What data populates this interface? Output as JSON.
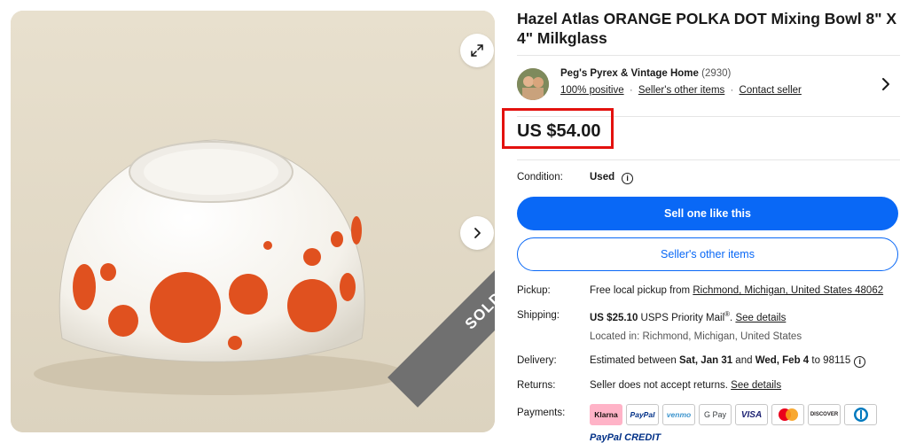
{
  "gallery": {
    "sold_label": "SOLD",
    "expand_icon": "expand-arrows-icon",
    "next_icon": "chevron-right-icon"
  },
  "listing": {
    "title": "Hazel Atlas ORANGE POLKA DOT Mixing Bowl 8\" X 4\" Milkglass",
    "price": "US $54.00"
  },
  "seller": {
    "name": "Peg's Pyrex & Vintage Home",
    "feedback_count": "(2930)",
    "positive": "100% positive",
    "other_items": "Seller's other items",
    "contact": "Contact seller",
    "separator": "·"
  },
  "condition": {
    "label": "Condition:",
    "value": "Used",
    "info_icon": "i"
  },
  "actions": {
    "sell_one": "Sell one like this",
    "other_items": "Seller's other items"
  },
  "pickup": {
    "label": "Pickup:",
    "text": "Free local pickup from ",
    "location": "Richmond, Michigan, United States 48062"
  },
  "shipping": {
    "label": "Shipping:",
    "cost": "US $25.10",
    "service": " USPS Priority Mail",
    "reg": "®",
    "sep": ". ",
    "details": "See details",
    "located": "Located in: Richmond, Michigan, United States"
  },
  "delivery": {
    "label": "Delivery:",
    "text1": "Estimated between ",
    "date1": "Sat, Jan 31",
    "text2": " and ",
    "date2": "Wed, Feb 4",
    "text3": " to 98115"
  },
  "returns": {
    "label": "Returns:",
    "text": "Seller does not accept returns. ",
    "details": "See details"
  },
  "payments": {
    "label": "Payments:",
    "methods": [
      "Klarna",
      "PayPal",
      "venmo",
      "G Pay",
      "VISA",
      "",
      "DISCOVER",
      ""
    ],
    "credit": "PayPal CREDIT"
  },
  "colors": {
    "primary_blue": "#0968f6",
    "highlight_red": "#e3110e",
    "sold_gray": "#707070",
    "dot_orange": "#e0511f"
  }
}
